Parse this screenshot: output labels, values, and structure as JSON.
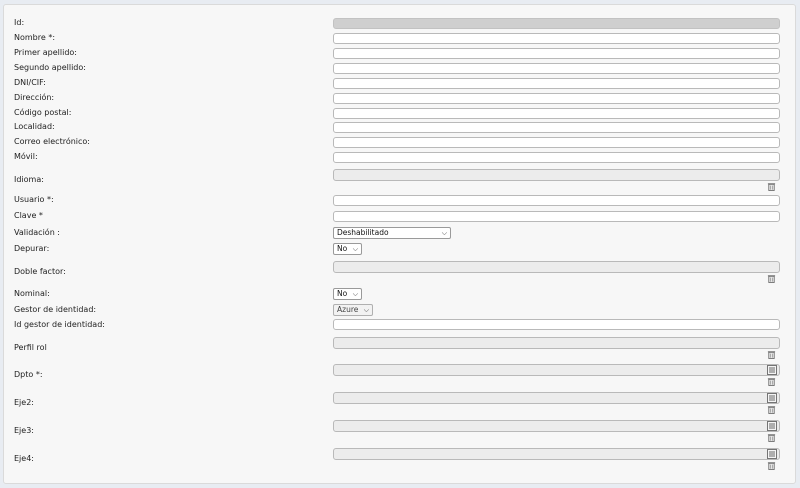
{
  "form": {
    "id_label": "Id:",
    "nombre_label": "Nombre *:",
    "primer_apellido_label": "Primer apellido:",
    "segundo_apellido_label": "Segundo apellido:",
    "dni_label": "DNI/CIF:",
    "direccion_label": "Dirección:",
    "codigo_postal_label": "Código postal:",
    "localidad_label": "Localidad:",
    "correo_label": "Correo electrónico:",
    "movil_label": "Móvil:",
    "idioma_label": "Idioma:",
    "usuario_label": "Usuario *:",
    "clave_label": "Clave *",
    "validacion_label": "Validación :",
    "validacion_value": "Deshabilitado",
    "depurar_label": "Depurar:",
    "depurar_value": "No",
    "doble_factor_label": "Doble factor:",
    "nominal_label": "Nominal:",
    "nominal_value": "No",
    "gestor_label": "Gestor de identidad:",
    "gestor_value": "Azure",
    "id_gestor_label": "Id gestor de identidad:",
    "perfil_rol_label": "Perfil rol",
    "dpto_label": "Dpto *:",
    "eje2_label": "Eje2:",
    "eje3_label": "Eje3:",
    "eje4_label": "Eje4:"
  },
  "icons": {
    "trash": "trash-icon",
    "list": "list-icon",
    "chevron": "chevron-down-icon"
  }
}
